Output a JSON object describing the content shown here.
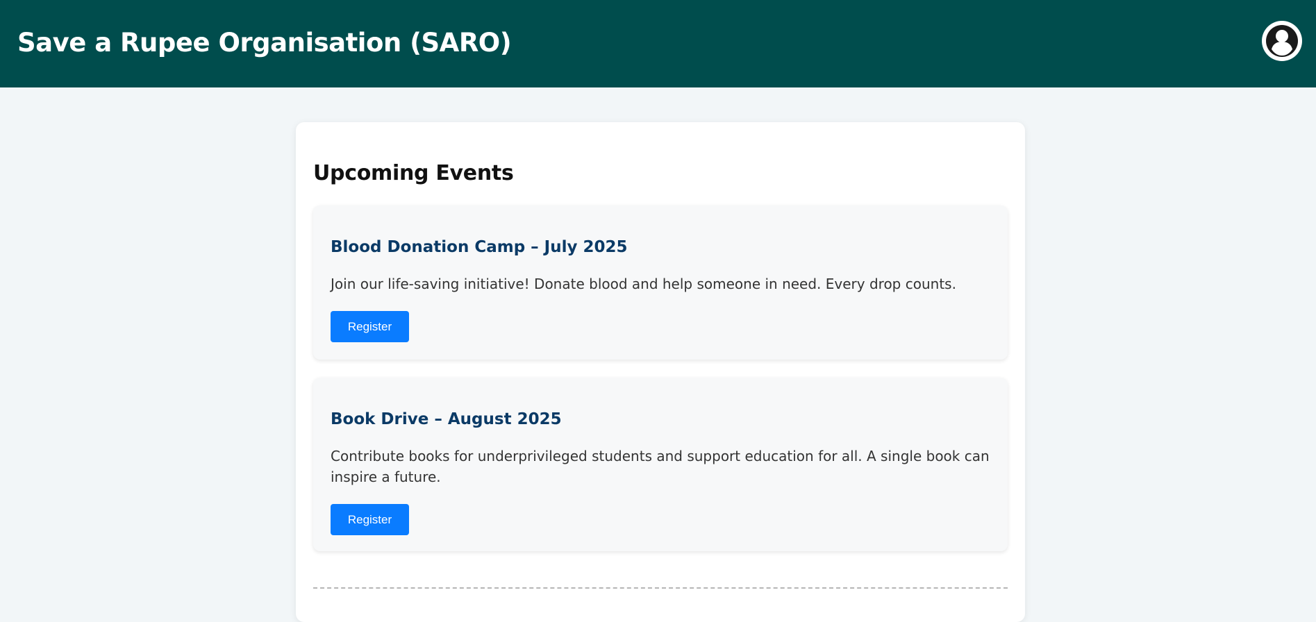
{
  "header": {
    "site_title": "Save a Rupee Organisation (SARO)",
    "profile_icon": "user-circle-icon",
    "background_color": "#004d4d"
  },
  "main": {
    "section_title": "Upcoming Events",
    "events": [
      {
        "title": "Blood Donation Camp – July 2025",
        "description": "Join our life-saving initiative! Donate blood and help someone in need. Every drop counts.",
        "button_label": "Register"
      },
      {
        "title": "Book Drive – August 2025",
        "description": "Contribute books for underprivileged students and support education for all. A single book can inspire a future.",
        "button_label": "Register"
      }
    ]
  },
  "colors": {
    "accent": "#0a7cff",
    "event_title": "#0b3a66",
    "page_background": "#f2f6f8"
  }
}
